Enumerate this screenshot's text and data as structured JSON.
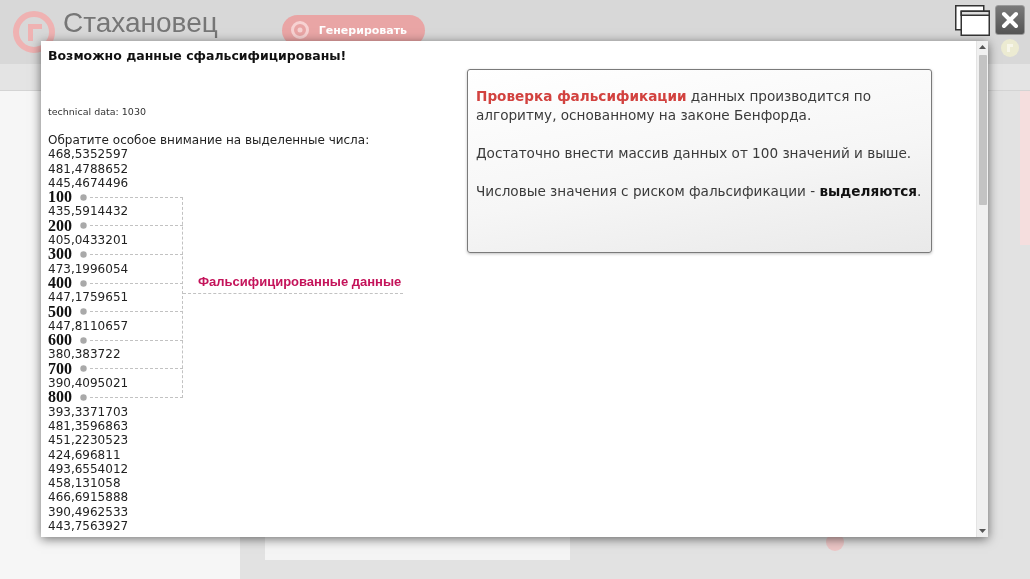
{
  "page": {
    "logo": "Стахановец",
    "generate_button": "Генерировать"
  },
  "dialog": {
    "title": "Возможно данные сфальсифицированы!",
    "technical_data": "technical data: 1030",
    "prompt": "Обратите особое внимание на выделенные числа:",
    "numbers": [
      {
        "text": "468,5352597",
        "flagged": false
      },
      {
        "text": "481,4788652",
        "flagged": false
      },
      {
        "text": "445,4674496",
        "flagged": false
      },
      {
        "text": "100",
        "flagged": true
      },
      {
        "text": "435,5914432",
        "flagged": false
      },
      {
        "text": "200",
        "flagged": true
      },
      {
        "text": "405,0433201",
        "flagged": false
      },
      {
        "text": "300",
        "flagged": true
      },
      {
        "text": "473,1996054",
        "flagged": false
      },
      {
        "text": "400",
        "flagged": true
      },
      {
        "text": "447,1759651",
        "flagged": false
      },
      {
        "text": "500",
        "flagged": true
      },
      {
        "text": "447,8110657",
        "flagged": false
      },
      {
        "text": "600",
        "flagged": true
      },
      {
        "text": "380,383722",
        "flagged": false
      },
      {
        "text": "700",
        "flagged": true
      },
      {
        "text": "390,4095021",
        "flagged": false
      },
      {
        "text": "800",
        "flagged": true
      },
      {
        "text": "393,3371703",
        "flagged": false
      },
      {
        "text": "481,3596863",
        "flagged": false
      },
      {
        "text": "451,2230523",
        "flagged": false
      },
      {
        "text": "424,696811",
        "flagged": false
      },
      {
        "text": "493,6554012",
        "flagged": false
      },
      {
        "text": "458,131058",
        "flagged": false
      },
      {
        "text": "466,6915888",
        "flagged": false
      },
      {
        "text": "390,4962533",
        "flagged": false
      },
      {
        "text": "443,7563927",
        "flagged": false
      }
    ],
    "callout": "Фальсифицированные данные",
    "info": [
      {
        "kind": "lead",
        "text": "**Проверка фальсификации** данных производится по алгоритму, основанному на законе Бенфорда."
      },
      {
        "kind": "plain",
        "text": "Достаточно внести массив данных от 100 значений и выше."
      },
      {
        "kind": "plain",
        "text": "Числовые значения с риском фальсификации - **выделяются**."
      }
    ]
  }
}
